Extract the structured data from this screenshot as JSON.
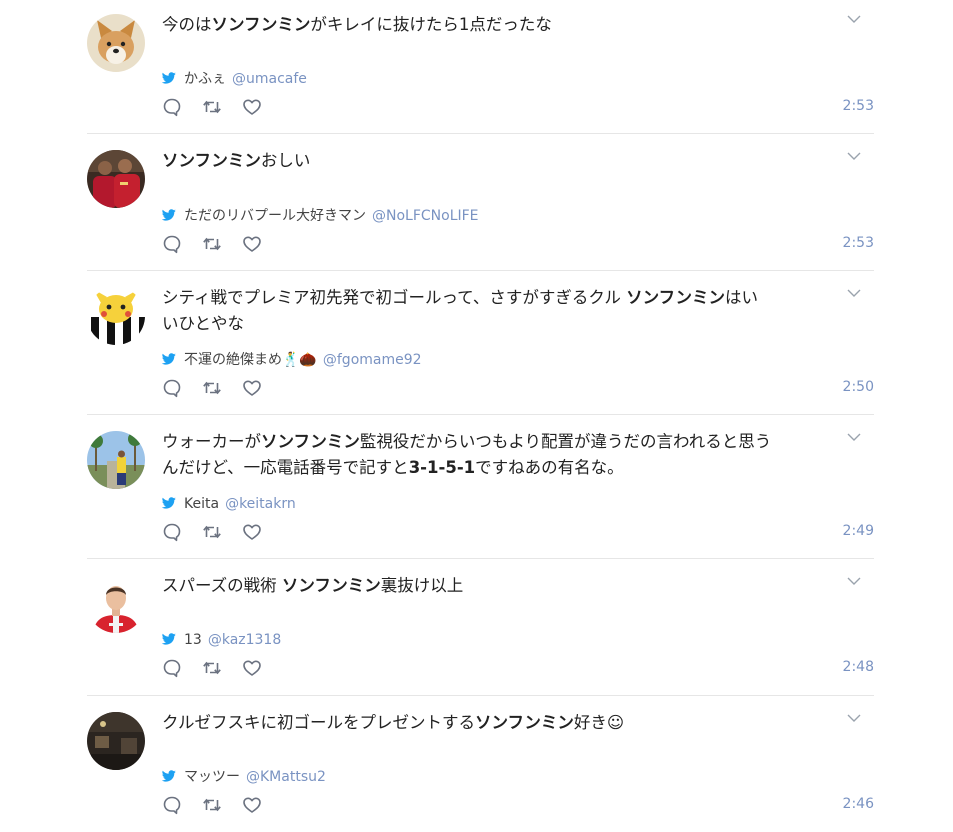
{
  "tweets": [
    {
      "text": [
        {
          "t": "今のは"
        },
        {
          "t": "ソンフンミン",
          "b": true
        },
        {
          "t": "がキレイに抜けたら1点だったな"
        }
      ],
      "name": "かふぇ",
      "handle": "@umacafe",
      "time": "2:53",
      "avatar": "avatar-corgi"
    },
    {
      "text": [
        {
          "t": "ソンフンミン",
          "b": true
        },
        {
          "t": "おしい"
        }
      ],
      "name": "ただのリバプール大好きマン",
      "handle": "@NoLFCNoLIFE",
      "time": "2:53",
      "avatar": "avatar-football-players"
    },
    {
      "text": [
        {
          "t": "シティ戦でプレミア初先発で初ゴールって、さすがすぎるクル "
        },
        {
          "t": "ソンフンミン",
          "b": true
        },
        {
          "t": "はい\nいひとやな"
        }
      ],
      "name": "不運の絶傑まめ🕺🌰",
      "handle": "@fgomame92",
      "time": "2:50",
      "avatar": "avatar-pikachu-juventus"
    },
    {
      "text": [
        {
          "t": "ウォーカーが"
        },
        {
          "t": "ソンフンミン",
          "b": true
        },
        {
          "t": "監視役だからいつもより配置が違うだの言われると思う\nんだけど、一応電話番号で記すと"
        },
        {
          "t": "3-1-5-1",
          "b": true
        },
        {
          "t": "ですねあの有名な。"
        }
      ],
      "name": "Keita",
      "handle": "@keitakrn",
      "time": "2:49",
      "avatar": "avatar-palm-street"
    },
    {
      "text": [
        {
          "t": "スパーズの戦術 "
        },
        {
          "t": "ソンフンミン",
          "b": true
        },
        {
          "t": "裏抜け以上"
        }
      ],
      "name": "13",
      "handle": "@kaz1318",
      "time": "2:48",
      "avatar": "avatar-arsenal-player"
    },
    {
      "text": [
        {
          "t": "クルゼフスキに初ゴールをプレゼントする"
        },
        {
          "t": "ソンフンミン",
          "b": true
        },
        {
          "t": "好き☺"
        }
      ],
      "name": "マッツー",
      "handle": "@KMattsu2",
      "time": "2:46",
      "avatar": "avatar-dark-room"
    }
  ],
  "icons": {
    "reply": "reply-icon",
    "retweet": "retweet-icon",
    "like": "heart-icon",
    "more": "chevron-down-icon",
    "source": "twitter-bird-icon"
  },
  "colors": {
    "link": "#7a93c2",
    "twitter": "#1da1f2",
    "icon": "#6b7280",
    "divider": "#e6e6e6"
  }
}
